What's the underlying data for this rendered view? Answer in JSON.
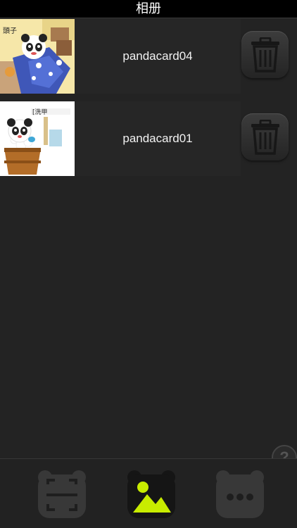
{
  "header": {
    "title": "相册"
  },
  "album": {
    "items": [
      {
        "label": "pandacard04",
        "thumbnail_icon": "panda-card-thumbnail-icon"
      },
      {
        "label": "pandacard01",
        "thumbnail_icon": "panda-card-thumbnail-icon"
      }
    ]
  },
  "help": {
    "label": "?"
  },
  "tab_bar": {
    "tabs": [
      {
        "icon": "scan-icon",
        "selected": false
      },
      {
        "icon": "photo-album-icon",
        "selected": true
      },
      {
        "icon": "more-icon",
        "selected": false
      }
    ]
  },
  "colors": {
    "accent": "#c8ec00",
    "background": "#232323",
    "title_bar": "#000000"
  }
}
